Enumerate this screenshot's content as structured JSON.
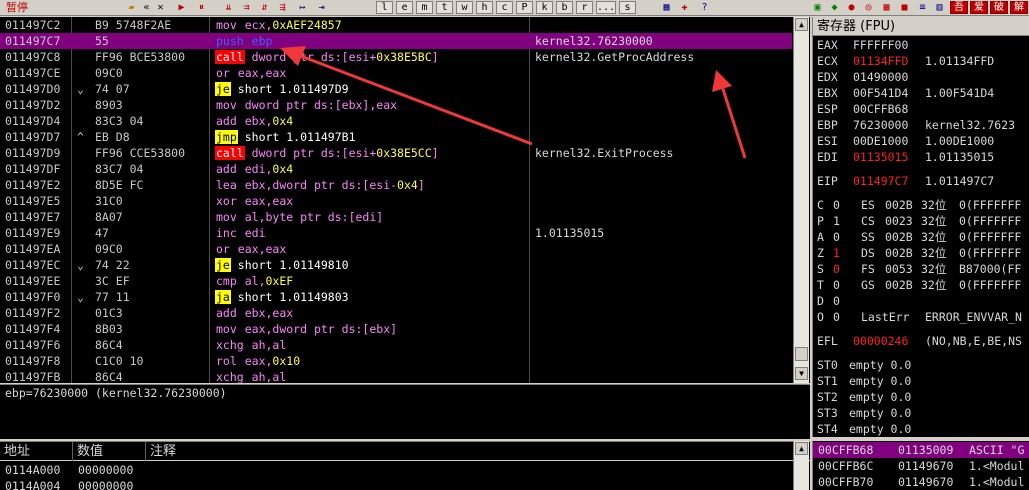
{
  "status_label": "暂停",
  "toolbar": {
    "letters": [
      "l",
      "e",
      "m",
      "t",
      "w",
      "h",
      "c",
      "P",
      "k",
      "b",
      "r",
      "...",
      "s"
    ],
    "icons": [
      "open-icon",
      "restart-icon",
      "close-icon",
      "run-icon",
      "pause-icon",
      "step-into-icon",
      "step-over-icon",
      "trace-into-icon",
      "trace-over-icon",
      "execute-till-return-icon",
      "goto-icon"
    ],
    "right_icons": [
      "layout-icon",
      "plugin-icon",
      "bug-icon",
      "options-icon",
      "window-icon",
      "help-icon"
    ],
    "right_labels": [
      "吾",
      "爱",
      "破",
      "解"
    ]
  },
  "disasm": {
    "rows": [
      {
        "addr": "011497C2",
        "mark": "",
        "hex": "B9 5748F2AE",
        "kw": "mov",
        "kwtype": "plain",
        "ops_pre": "ecx,",
        "num": "0xAEF24857",
        "ops_post": "",
        "comment": ""
      },
      {
        "addr": "011497C7",
        "mark": "",
        "hex": "55",
        "kw": "push",
        "kwtype": "push",
        "ops_pre": "ebp",
        "num": "",
        "ops_post": "",
        "comment": "kernel32.76230000",
        "selected": true
      },
      {
        "addr": "011497C8",
        "mark": "",
        "hex": "FF96 BCE53800",
        "kw": "call",
        "kwtype": "call",
        "ops_pre": "dword ptr ds:[esi+",
        "num": "0x38E5BC",
        "ops_post": "]",
        "comment": "kernel32.GetProcAddress"
      },
      {
        "addr": "011497CE",
        "mark": "",
        "hex": "09C0",
        "kw": "or",
        "kwtype": "plain",
        "ops_pre": "eax,eax",
        "num": "",
        "ops_post": "",
        "comment": ""
      },
      {
        "addr": "011497D0",
        "mark": "⌄",
        "hex": "74 07",
        "kw": "je",
        "kwtype": "jmp",
        "ops_pre": "short 1.011497D9",
        "num": "",
        "ops_post": "",
        "comment": ""
      },
      {
        "addr": "011497D2",
        "mark": "",
        "hex": "8903",
        "kw": "mov",
        "kwtype": "plain",
        "ops_pre": "dword ptr ds:[ebx],eax",
        "num": "",
        "ops_post": "",
        "comment": ""
      },
      {
        "addr": "011497D4",
        "mark": "",
        "hex": "83C3 04",
        "kw": "add",
        "kwtype": "plain",
        "ops_pre": "ebx,",
        "num": "0x4",
        "ops_post": "",
        "comment": ""
      },
      {
        "addr": "011497D7",
        "mark": "^",
        "hex": "EB D8",
        "kw": "jmp",
        "kwtype": "jmp",
        "ops_pre": "short 1.011497B1",
        "num": "",
        "ops_post": "",
        "comment": ""
      },
      {
        "addr": "011497D9",
        "mark": "",
        "hex": "FF96 CCE53800",
        "kw": "call",
        "kwtype": "call",
        "ops_pre": "dword ptr ds:[esi+",
        "num": "0x38E5CC",
        "ops_post": "]",
        "comment": "kernel32.ExitProcess"
      },
      {
        "addr": "011497DF",
        "mark": "",
        "hex": "83C7 04",
        "kw": "add",
        "kwtype": "plain",
        "ops_pre": "edi,",
        "num": "0x4",
        "ops_post": "",
        "comment": ""
      },
      {
        "addr": "011497E2",
        "mark": "",
        "hex": "8D5E FC",
        "kw": "lea",
        "kwtype": "plain",
        "ops_pre": "ebx,dword ptr ds:[esi-",
        "num": "0x4",
        "ops_post": "]",
        "comment": ""
      },
      {
        "addr": "011497E5",
        "mark": "",
        "hex": "31C0",
        "kw": "xor",
        "kwtype": "plain",
        "ops_pre": "eax,eax",
        "num": "",
        "ops_post": "",
        "comment": ""
      },
      {
        "addr": "011497E7",
        "mark": "",
        "hex": "8A07",
        "kw": "mov",
        "kwtype": "plain",
        "ops_pre": "al,byte ptr ds:[edi]",
        "num": "",
        "ops_post": "",
        "comment": ""
      },
      {
        "addr": "011497E9",
        "mark": "",
        "hex": "47",
        "kw": "inc",
        "kwtype": "plain",
        "ops_pre": "edi",
        "num": "",
        "ops_post": "",
        "comment": "1.01135015"
      },
      {
        "addr": "011497EA",
        "mark": "",
        "hex": "09C0",
        "kw": "or",
        "kwtype": "plain",
        "ops_pre": "eax,eax",
        "num": "",
        "ops_post": "",
        "comment": ""
      },
      {
        "addr": "011497EC",
        "mark": "⌄",
        "hex": "74 22",
        "kw": "je",
        "kwtype": "jmp",
        "ops_pre": "short 1.01149810",
        "num": "",
        "ops_post": "",
        "comment": ""
      },
      {
        "addr": "011497EE",
        "mark": "",
        "hex": "3C EF",
        "kw": "cmp",
        "kwtype": "plain",
        "ops_pre": "al,",
        "num": "0xEF",
        "ops_post": "",
        "comment": ""
      },
      {
        "addr": "011497F0",
        "mark": "⌄",
        "hex": "77 11",
        "kw": "ja",
        "kwtype": "jmp",
        "ops_pre": "short 1.01149803",
        "num": "",
        "ops_post": "",
        "comment": ""
      },
      {
        "addr": "011497F2",
        "mark": "",
        "hex": "01C3",
        "kw": "add",
        "kwtype": "plain",
        "ops_pre": "ebx,eax",
        "num": "",
        "ops_post": "",
        "comment": ""
      },
      {
        "addr": "011497F4",
        "mark": "",
        "hex": "8B03",
        "kw": "mov",
        "kwtype": "plain",
        "ops_pre": "eax,dword ptr ds:[ebx]",
        "num": "",
        "ops_post": "",
        "comment": ""
      },
      {
        "addr": "011497F6",
        "mark": "",
        "hex": "86C4",
        "kw": "xchg",
        "kwtype": "plain",
        "ops_pre": "ah,al",
        "num": "",
        "ops_post": "",
        "comment": ""
      },
      {
        "addr": "011497F8",
        "mark": "",
        "hex": "C1C0 10",
        "kw": "rol",
        "kwtype": "plain",
        "ops_pre": "eax,",
        "num": "0x10",
        "ops_post": "",
        "comment": ""
      },
      {
        "addr": "011497FB",
        "mark": "",
        "hex": "86C4",
        "kw": "xchg",
        "kwtype": "plain",
        "ops_pre": "ah,al",
        "num": "",
        "ops_post": "",
        "comment": ""
      }
    ]
  },
  "info_line": "ebp=76230000 (kernel32.76230000)",
  "dump": {
    "headers": [
      "地址",
      "数值",
      "注释"
    ],
    "rows": [
      {
        "addr": "0114A000",
        "value": "00000000"
      },
      {
        "addr": "0114A004",
        "value": "00000000"
      }
    ]
  },
  "registers": {
    "header": "寄存器 (FPU)",
    "general": [
      {
        "name": "EAX",
        "value": "FFFFFF00",
        "note": "",
        "hl": false
      },
      {
        "name": "ECX",
        "value": "01134FFD",
        "note": "1.01134FFD",
        "hl": true
      },
      {
        "name": "EDX",
        "value": "01490000",
        "note": "",
        "hl": false
      },
      {
        "name": "EBX",
        "value": "00F541D4",
        "note": "1.00F541D4",
        "hl": false
      },
      {
        "name": "ESP",
        "value": "00CFFB68",
        "note": "",
        "hl": false
      },
      {
        "name": "EBP",
        "value": "76230000",
        "note": "kernel32.7623",
        "hl": false
      },
      {
        "name": "ESI",
        "value": "00DE1000",
        "note": "1.00DE1000",
        "hl": false
      },
      {
        "name": "EDI",
        "value": "01135015",
        "note": "1.01135015",
        "hl": true
      }
    ],
    "eip": {
      "name": "EIP",
      "value": "011497C7",
      "note": "1.011497C7"
    },
    "segments": [
      {
        "flag": "C",
        "fval": "0",
        "seg": "ES",
        "sel": "002B",
        "bits": "32位",
        "range": "0(FFFFFFF",
        "hl": false
      },
      {
        "flag": "P",
        "fval": "1",
        "seg": "CS",
        "sel": "0023",
        "bits": "32位",
        "range": "0(FFFFFFF",
        "hl": false
      },
      {
        "flag": "A",
        "fval": "0",
        "seg": "SS",
        "sel": "002B",
        "bits": "32位",
        "range": "0(FFFFFFF",
        "hl": false
      },
      {
        "flag": "Z",
        "fval": "1",
        "seg": "DS",
        "sel": "002B",
        "bits": "32位",
        "range": "0(FFFFFFF",
        "hl": true
      },
      {
        "flag": "S",
        "fval": "0",
        "seg": "FS",
        "sel": "0053",
        "bits": "32位",
        "range": "B87000(FF",
        "hl": true
      },
      {
        "flag": "T",
        "fval": "0",
        "seg": "GS",
        "sel": "002B",
        "bits": "32位",
        "range": "0(FFFFFFF",
        "hl": false
      }
    ],
    "flag_d": {
      "flag": "D",
      "fval": "0"
    },
    "flag_o": {
      "flag": "O",
      "fval": "0",
      "label": "LastErr",
      "value": "ERROR_ENVVAR_N"
    },
    "efl": {
      "name": "EFL",
      "value": "00000246",
      "note": "(NO,NB,E,BE,NS"
    },
    "fpu": [
      {
        "name": "ST0",
        "value": "empty 0.0"
      },
      {
        "name": "ST1",
        "value": "empty 0.0"
      },
      {
        "name": "ST2",
        "value": "empty 0.0"
      },
      {
        "name": "ST3",
        "value": "empty 0.0"
      },
      {
        "name": "ST4",
        "value": "empty 0.0"
      }
    ]
  },
  "stack": {
    "rows": [
      {
        "addr": "00CFFB68",
        "value": "01135009",
        "comment": "ASCII \"G",
        "selected": true
      },
      {
        "addr": "00CFFB6C",
        "value": "01149670",
        "comment": "1.<Modul",
        "selected": false
      },
      {
        "addr": "00CFFB70",
        "value": "01149670",
        "comment": "1.<Modul",
        "selected": false
      }
    ]
  }
}
